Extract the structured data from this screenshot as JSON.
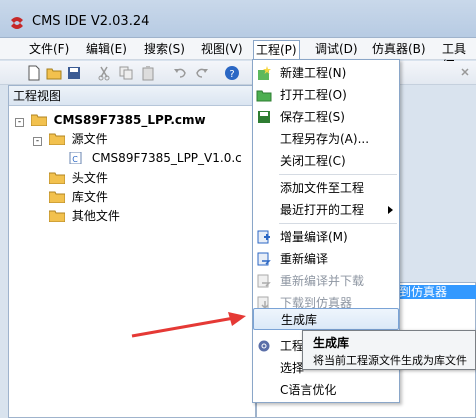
{
  "window": {
    "title": "CMS IDE V2.03.24"
  },
  "menubar": {
    "items": [
      "文件(F)",
      "编辑(E)",
      "搜索(S)",
      "视图(V)",
      "工程(P)",
      "调试(D)",
      "仿真器(B)",
      "工具(T"
    ]
  },
  "project_panel": {
    "title": "工程视图",
    "tree": [
      {
        "label": "CMS89F7385_LPP.cmw"
      },
      {
        "label": "源文件"
      },
      {
        "label": "CMS89F7385_LPP_V1.0.c"
      },
      {
        "label": "头文件"
      },
      {
        "label": "库文件"
      },
      {
        "label": "其他文件"
      }
    ]
  },
  "output_panel": {
    "highlight_text": "到仿真器"
  },
  "project_menu": {
    "items": [
      {
        "label": "新建工程(N)",
        "icon": "new-project-icon"
      },
      {
        "label": "打开工程(O)",
        "icon": "open-folder-icon"
      },
      {
        "label": "保存工程(S)",
        "icon": "save-icon"
      },
      {
        "label": "工程另存为(A)...",
        "icon": ""
      },
      {
        "label": "关闭工程(C)",
        "icon": ""
      },
      {
        "label": "添加文件至工程",
        "icon": ""
      },
      {
        "label": "最近打开的工程",
        "icon": "",
        "has_submenu": true
      },
      {
        "label": "增量编译(M)",
        "icon": "incremental-build-icon"
      },
      {
        "label": "重新编译",
        "icon": "rebuild-icon"
      },
      {
        "label": "重新编译并下载",
        "icon": "rebuild-download-icon",
        "disabled": true
      },
      {
        "label": "下载到仿真器",
        "icon": "download-icon",
        "disabled": true
      },
      {
        "label": "生成库",
        "icon": "",
        "hovered": true
      },
      {
        "label": "工程",
        "icon": "settings-icon"
      },
      {
        "label": "选择",
        "icon": ""
      },
      {
        "label": "C语言优化",
        "icon": ""
      }
    ]
  },
  "tooltip": {
    "title": "生成库",
    "description": "将当前工程源文件生成为库文件"
  },
  "colors": {
    "arrow": "#e53935",
    "accent": "#3399ff"
  }
}
